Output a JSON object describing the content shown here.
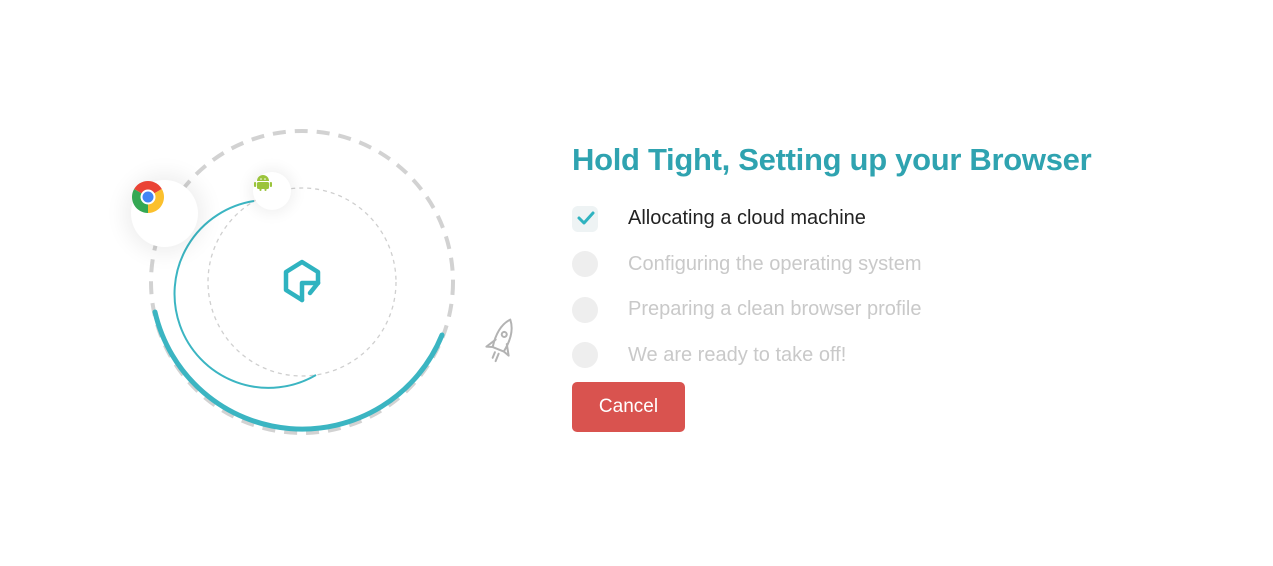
{
  "title": "Hold Tight, Setting up your Browser",
  "steps": [
    {
      "label": "Allocating a cloud machine",
      "status": "done"
    },
    {
      "label": "Configuring the operating system",
      "status": "pending"
    },
    {
      "label": "Preparing a clean browser profile",
      "status": "pending"
    },
    {
      "label": "We are ready to take off!",
      "status": "pending"
    }
  ],
  "cancel_label": "Cancel",
  "icons": {
    "browser": "chrome-icon",
    "os": "android-icon",
    "center": "cloud-logo-icon",
    "launch": "rocket-icon",
    "check": "checkmark-icon"
  },
  "colors": {
    "accent": "#2fa3b0",
    "progress": "#3bb5c2",
    "cancel": "#d9534f",
    "pending": "#c9c9c9"
  }
}
